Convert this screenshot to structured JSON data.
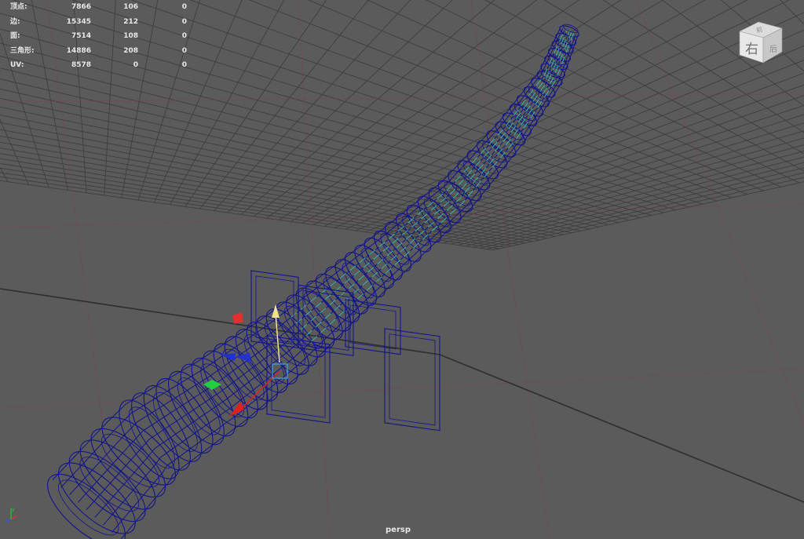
{
  "hud": {
    "rows": [
      {
        "label": "顶点:",
        "c1": "7866",
        "c2": "106",
        "c3": "0"
      },
      {
        "label": "边:",
        "c1": "15345",
        "c2": "212",
        "c3": "0"
      },
      {
        "label": "面:",
        "c1": "7514",
        "c2": "108",
        "c3": "0"
      },
      {
        "label": "三角形:",
        "c1": "14886",
        "c2": "208",
        "c3": "0"
      },
      {
        "label": "UV:",
        "c1": "8578",
        "c2": "0",
        "c3": "0"
      }
    ]
  },
  "viewport": {
    "camera": "persp",
    "background": "#5b5b5b",
    "grid_color": "#3e3e3e",
    "axis_color": "#8a3c44"
  },
  "viewcube": {
    "front_label": "右",
    "top_label": "前",
    "side_label": "后"
  },
  "mesh": {
    "wire_color": "#12148a",
    "highlight_color": "#40e0a0"
  },
  "manipulator": {
    "y_color": "#f0e090",
    "x_color": "#e02020",
    "z_color": "#2030e0",
    "center_color": "#40a8e0"
  }
}
